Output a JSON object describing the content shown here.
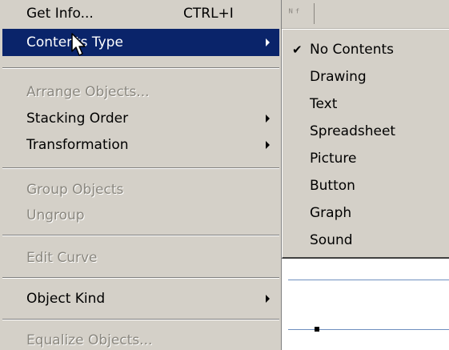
{
  "menu": {
    "items": [
      {
        "label": "Get Info...",
        "shortcut": "CTRL+I"
      },
      {
        "label": "Contents Type"
      },
      {
        "label": "Arrange Objects..."
      },
      {
        "label": "Stacking Order"
      },
      {
        "label": "Transformation"
      },
      {
        "label": "Group Objects"
      },
      {
        "label": "Ungroup"
      },
      {
        "label": "Edit Curve"
      },
      {
        "label": "Object Kind"
      },
      {
        "label": "Equalize Objects..."
      }
    ]
  },
  "submenu": {
    "check_glyph": "✔",
    "items": [
      {
        "label": "No Contents"
      },
      {
        "label": "Drawing"
      },
      {
        "label": "Text"
      },
      {
        "label": "Spreadsheet"
      },
      {
        "label": "Picture"
      },
      {
        "label": "Button"
      },
      {
        "label": "Graph"
      },
      {
        "label": "Sound"
      }
    ]
  },
  "toolbar": {
    "icon_glyph": "ᴺᶠ"
  },
  "colors": {
    "menu_bg": "#d4d0c8",
    "highlight": "#0a246a",
    "disabled_text": "#8a877f"
  }
}
